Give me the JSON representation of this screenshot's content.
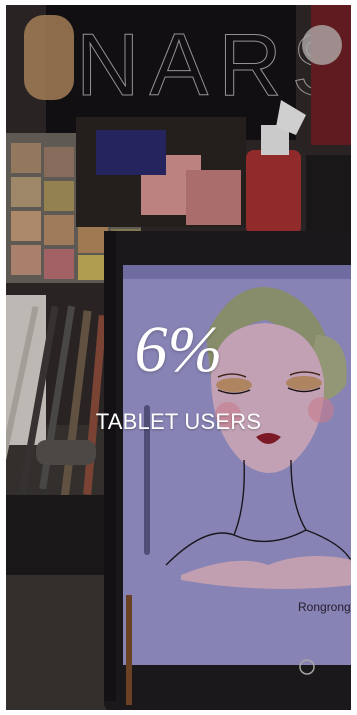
{
  "story": {
    "stat_value": "6%",
    "stat_label": "TABLET USERS"
  },
  "photo": {
    "brand_text": "NARS",
    "signature": "Rongrong"
  },
  "colors": {
    "text": "#ffffff",
    "tablet_screen": "#9a97cf",
    "tablet_frame": "#1e1c1e"
  }
}
